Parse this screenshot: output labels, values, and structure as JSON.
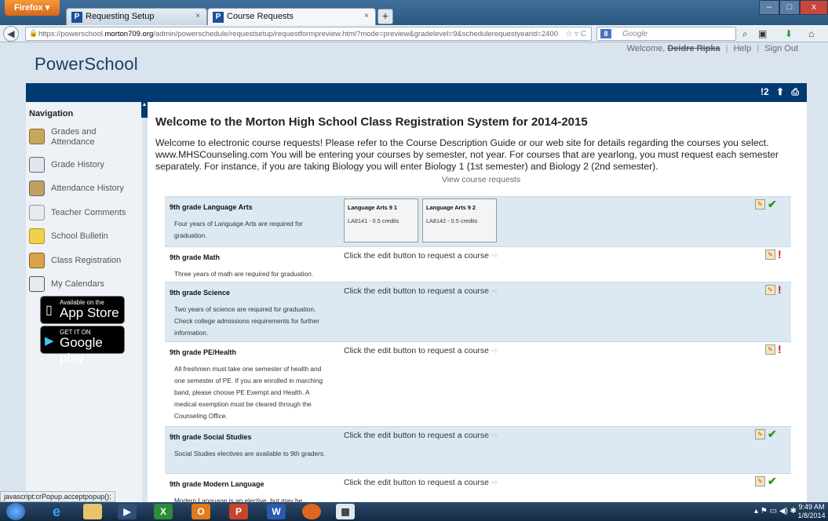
{
  "browser": {
    "app_button": "Firefox ▾",
    "tabs": [
      {
        "label": "Requesting Setup",
        "close": "×"
      },
      {
        "label": "Course Requests",
        "close": "×"
      }
    ],
    "new_tab": "+",
    "url_prefix": "https://powerschool.",
    "url_host": "morton709.org",
    "url_suffix": "/admin/powerschedule/requestsetup/requestformpreview.html?mode=preview&gradelevel=9&schedulerequestyearid=2400",
    "search_placeholder": "Google",
    "search_engine_letter": "8",
    "window_controls": {
      "minimize": "–",
      "maximize": "□",
      "close": "x"
    }
  },
  "header": {
    "logo": "PowerSchool",
    "welcome": "Welcome,",
    "user_name": "Deidre Ripka",
    "help": "Help",
    "sign_out": "Sign Out",
    "separator": "|",
    "notifications": "!2"
  },
  "sidebar": {
    "heading": "Navigation",
    "items": [
      {
        "label": "Grades and Attendance",
        "icon": "gradebook-icon"
      },
      {
        "label": "Grade History",
        "icon": "grade-history-icon"
      },
      {
        "label": "Attendance History",
        "icon": "attendance-icon"
      },
      {
        "label": "Teacher Comments",
        "icon": "comment-icon"
      },
      {
        "label": "School Bulletin",
        "icon": "bulletin-icon"
      },
      {
        "label": "Class Registration",
        "icon": "registration-icon"
      },
      {
        "label": "My Calendars",
        "icon": "calendar-icon"
      }
    ],
    "app_store": {
      "small": "Available on the",
      "big": "App Store"
    },
    "google_play": {
      "small": "GET IT ON",
      "big": "Google play"
    }
  },
  "main": {
    "title": "Welcome to the Morton High School Class Registration System for 2014-2015",
    "intro": "Welcome to electronic course requests! Please refer to the Course Description Guide or our web site for details regarding the courses you select. www.MHSCounseling.com You will be entering your courses by semester, not year. For courses that are yearlong, you must request each semester separately. For instance, if you are taking Biology you will enter Biology 1 (1st semester) and Biology 2 (2nd semester).",
    "view_link": "View course requests",
    "edit_prompt": "Click the edit button to request a course",
    "prompt_arrow": "⇨",
    "requests": [
      {
        "title": "9th grade Language Arts",
        "description": "Four years of Language Arts are required for graduation.",
        "status": "complete",
        "courses": [
          {
            "name": "Language Arts 9 1",
            "credits": "LA8141 - 0.5 credits"
          },
          {
            "name": "Language Arts 9 2",
            "credits": "LA8142 - 0.5 credits"
          }
        ]
      },
      {
        "title": "9th grade Math",
        "description": "Three years of math are required for graduation.",
        "status": "required",
        "courses": []
      },
      {
        "title": "9th grade Science",
        "description": "Two years of science are required for graduation. Check college admissions requirements for further information.",
        "status": "required",
        "courses": []
      },
      {
        "title": "9th grade PE/Health",
        "description": "All freshmen must take one semester of health and one semester of PE. If you are enrolled in marching band, please choose PE Exempt and Health. A medical exemption must be cleared through the Counseling Office.",
        "status": "required",
        "courses": []
      },
      {
        "title": "9th grade Social Studies",
        "description": "Social Studies electives are available to 9th graders.",
        "status": "complete",
        "courses": []
      },
      {
        "title": "9th grade Modern Language",
        "description": "Modern Language is an elective, but may be",
        "status": "complete",
        "courses": []
      }
    ],
    "status_symbols": {
      "complete": "✔",
      "required": "!"
    }
  },
  "statusbar": {
    "text": "javascript:crPopup.acceptpopup();"
  },
  "taskbar": {
    "time": "9:49 AM",
    "date": "1/8/2014"
  },
  "colors": {
    "header_blue": "#003a70",
    "row_shade": "#dce9f2",
    "ok_green": "#2b9a1a",
    "required_red": "#d0141a"
  }
}
